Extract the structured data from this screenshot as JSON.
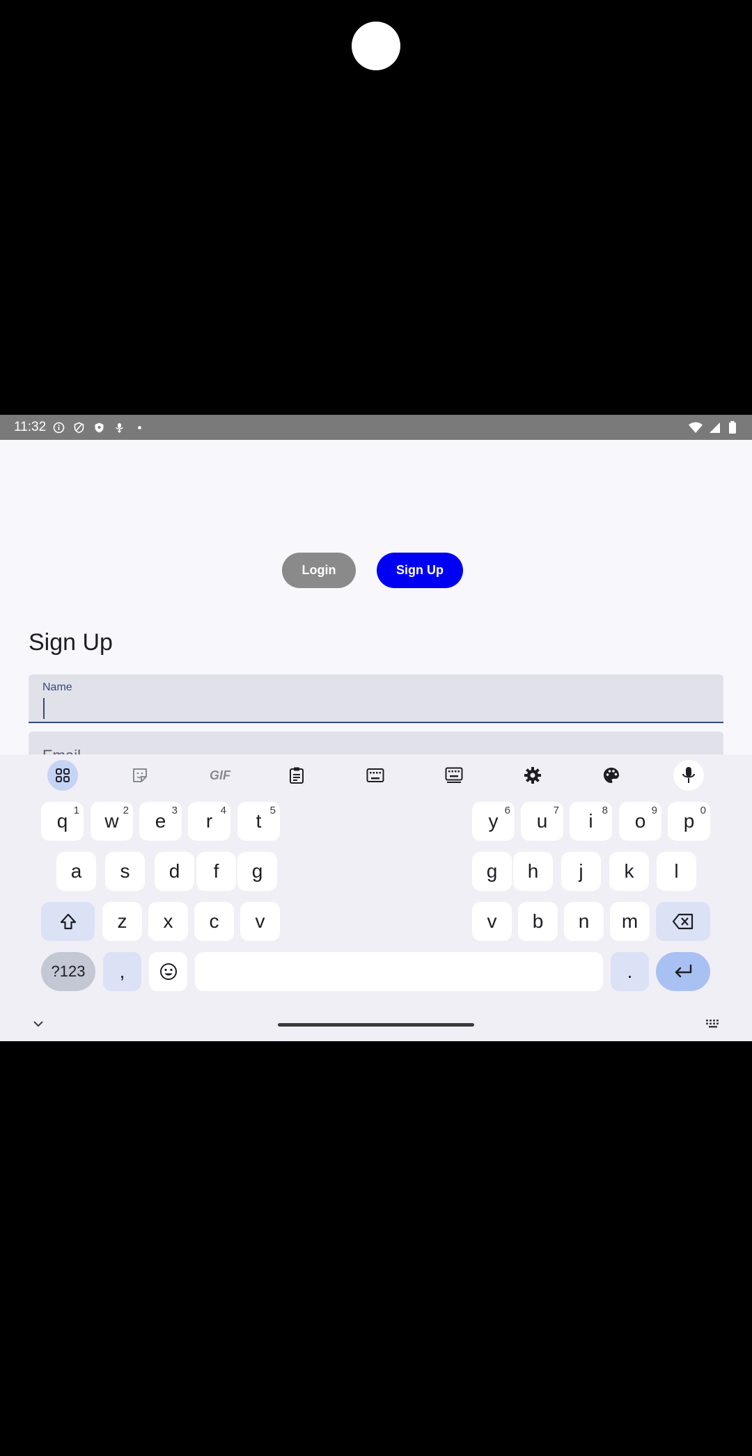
{
  "status_bar": {
    "time": "11:32",
    "left_icons": [
      "info-icon",
      "shield-outline-icon",
      "shield-filled-icon",
      "mic-download-icon",
      "dot-icon"
    ],
    "right_icons": [
      "wifi-icon",
      "signal-icon",
      "battery-icon"
    ]
  },
  "auth_toggle": {
    "login_label": "Login",
    "signup_label": "Sign Up",
    "active": "signup",
    "colors": {
      "login_bg": "#8a8a8a",
      "signup_bg": "#0000f2"
    }
  },
  "form": {
    "title": "Sign Up",
    "name_label": "Name",
    "name_value": "",
    "email_label": "Email"
  },
  "keyboard": {
    "toolbar": [
      "apps-grid-icon",
      "sticker-icon",
      "gif-icon",
      "clipboard-icon",
      "keyboard-icon",
      "keyboard-split-icon",
      "gear-icon",
      "palette-icon",
      "mic-icon"
    ],
    "gif_label": "GIF",
    "row1": [
      {
        "k": "q",
        "h": "1"
      },
      {
        "k": "w",
        "h": "2"
      },
      {
        "k": "e",
        "h": "3"
      },
      {
        "k": "r",
        "h": "4"
      },
      {
        "k": "t",
        "h": "5"
      },
      {
        "k": "y",
        "h": "6"
      },
      {
        "k": "u",
        "h": "7"
      },
      {
        "k": "i",
        "h": "8"
      },
      {
        "k": "o",
        "h": "9"
      },
      {
        "k": "p",
        "h": "0"
      }
    ],
    "row2": [
      "a",
      "s",
      "d",
      "f",
      "g",
      "g",
      "h",
      "j",
      "k",
      "l"
    ],
    "row3": [
      "z",
      "x",
      "c",
      "v",
      "v",
      "b",
      "n",
      "m"
    ],
    "symbols_label": "?123",
    "comma_label": ",",
    "period_label": "."
  }
}
